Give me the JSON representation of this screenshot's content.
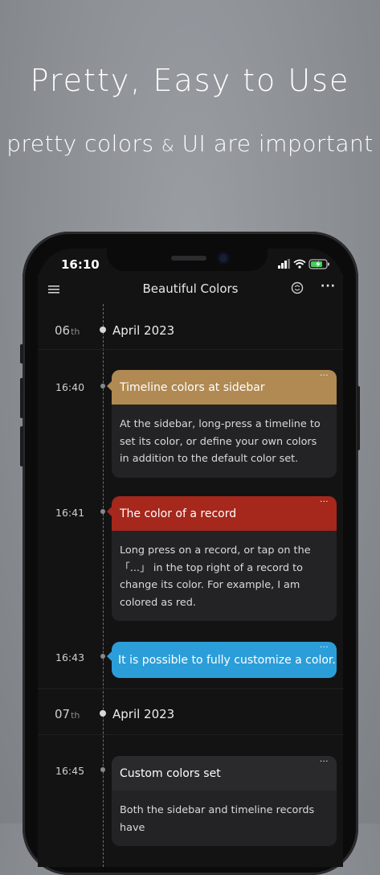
{
  "promo": {
    "headline": "Pretty, Easy to Use",
    "subhead_part1": "pretty colors",
    "subhead_amp": "&",
    "subhead_part2": "UI are important"
  },
  "status_bar": {
    "time": "16:10"
  },
  "nav": {
    "title": "Beautiful Colors",
    "more": "···"
  },
  "timeline": {
    "days": [
      {
        "day": "06",
        "suffix": "th",
        "month_year": "April 2023"
      },
      {
        "day": "07",
        "suffix": "th",
        "month_year": "April 2023"
      }
    ],
    "records": [
      {
        "time": "16:40",
        "title": "Timeline colors at sidebar",
        "body": "At the sidebar, long-press a timeline to set its color, or define your own colors in addition to the default color set.",
        "color": "#b08a52",
        "more": "···"
      },
      {
        "time": "16:41",
        "title": "The color of a record",
        "body": "Long press on a record, or tap on the 「...」 in the top right of a record to change its color. For example, I am colored as red.",
        "color": "#a6271c",
        "more": "···"
      },
      {
        "time": "16:43",
        "title": "It is possible to fully customize a color.",
        "color": "#2b9ed9",
        "more": "···"
      },
      {
        "time": "16:45",
        "title": "Custom colors set",
        "body": "Both the sidebar and timeline records have",
        "color": "#2a2a2c",
        "more": "···"
      }
    ]
  }
}
